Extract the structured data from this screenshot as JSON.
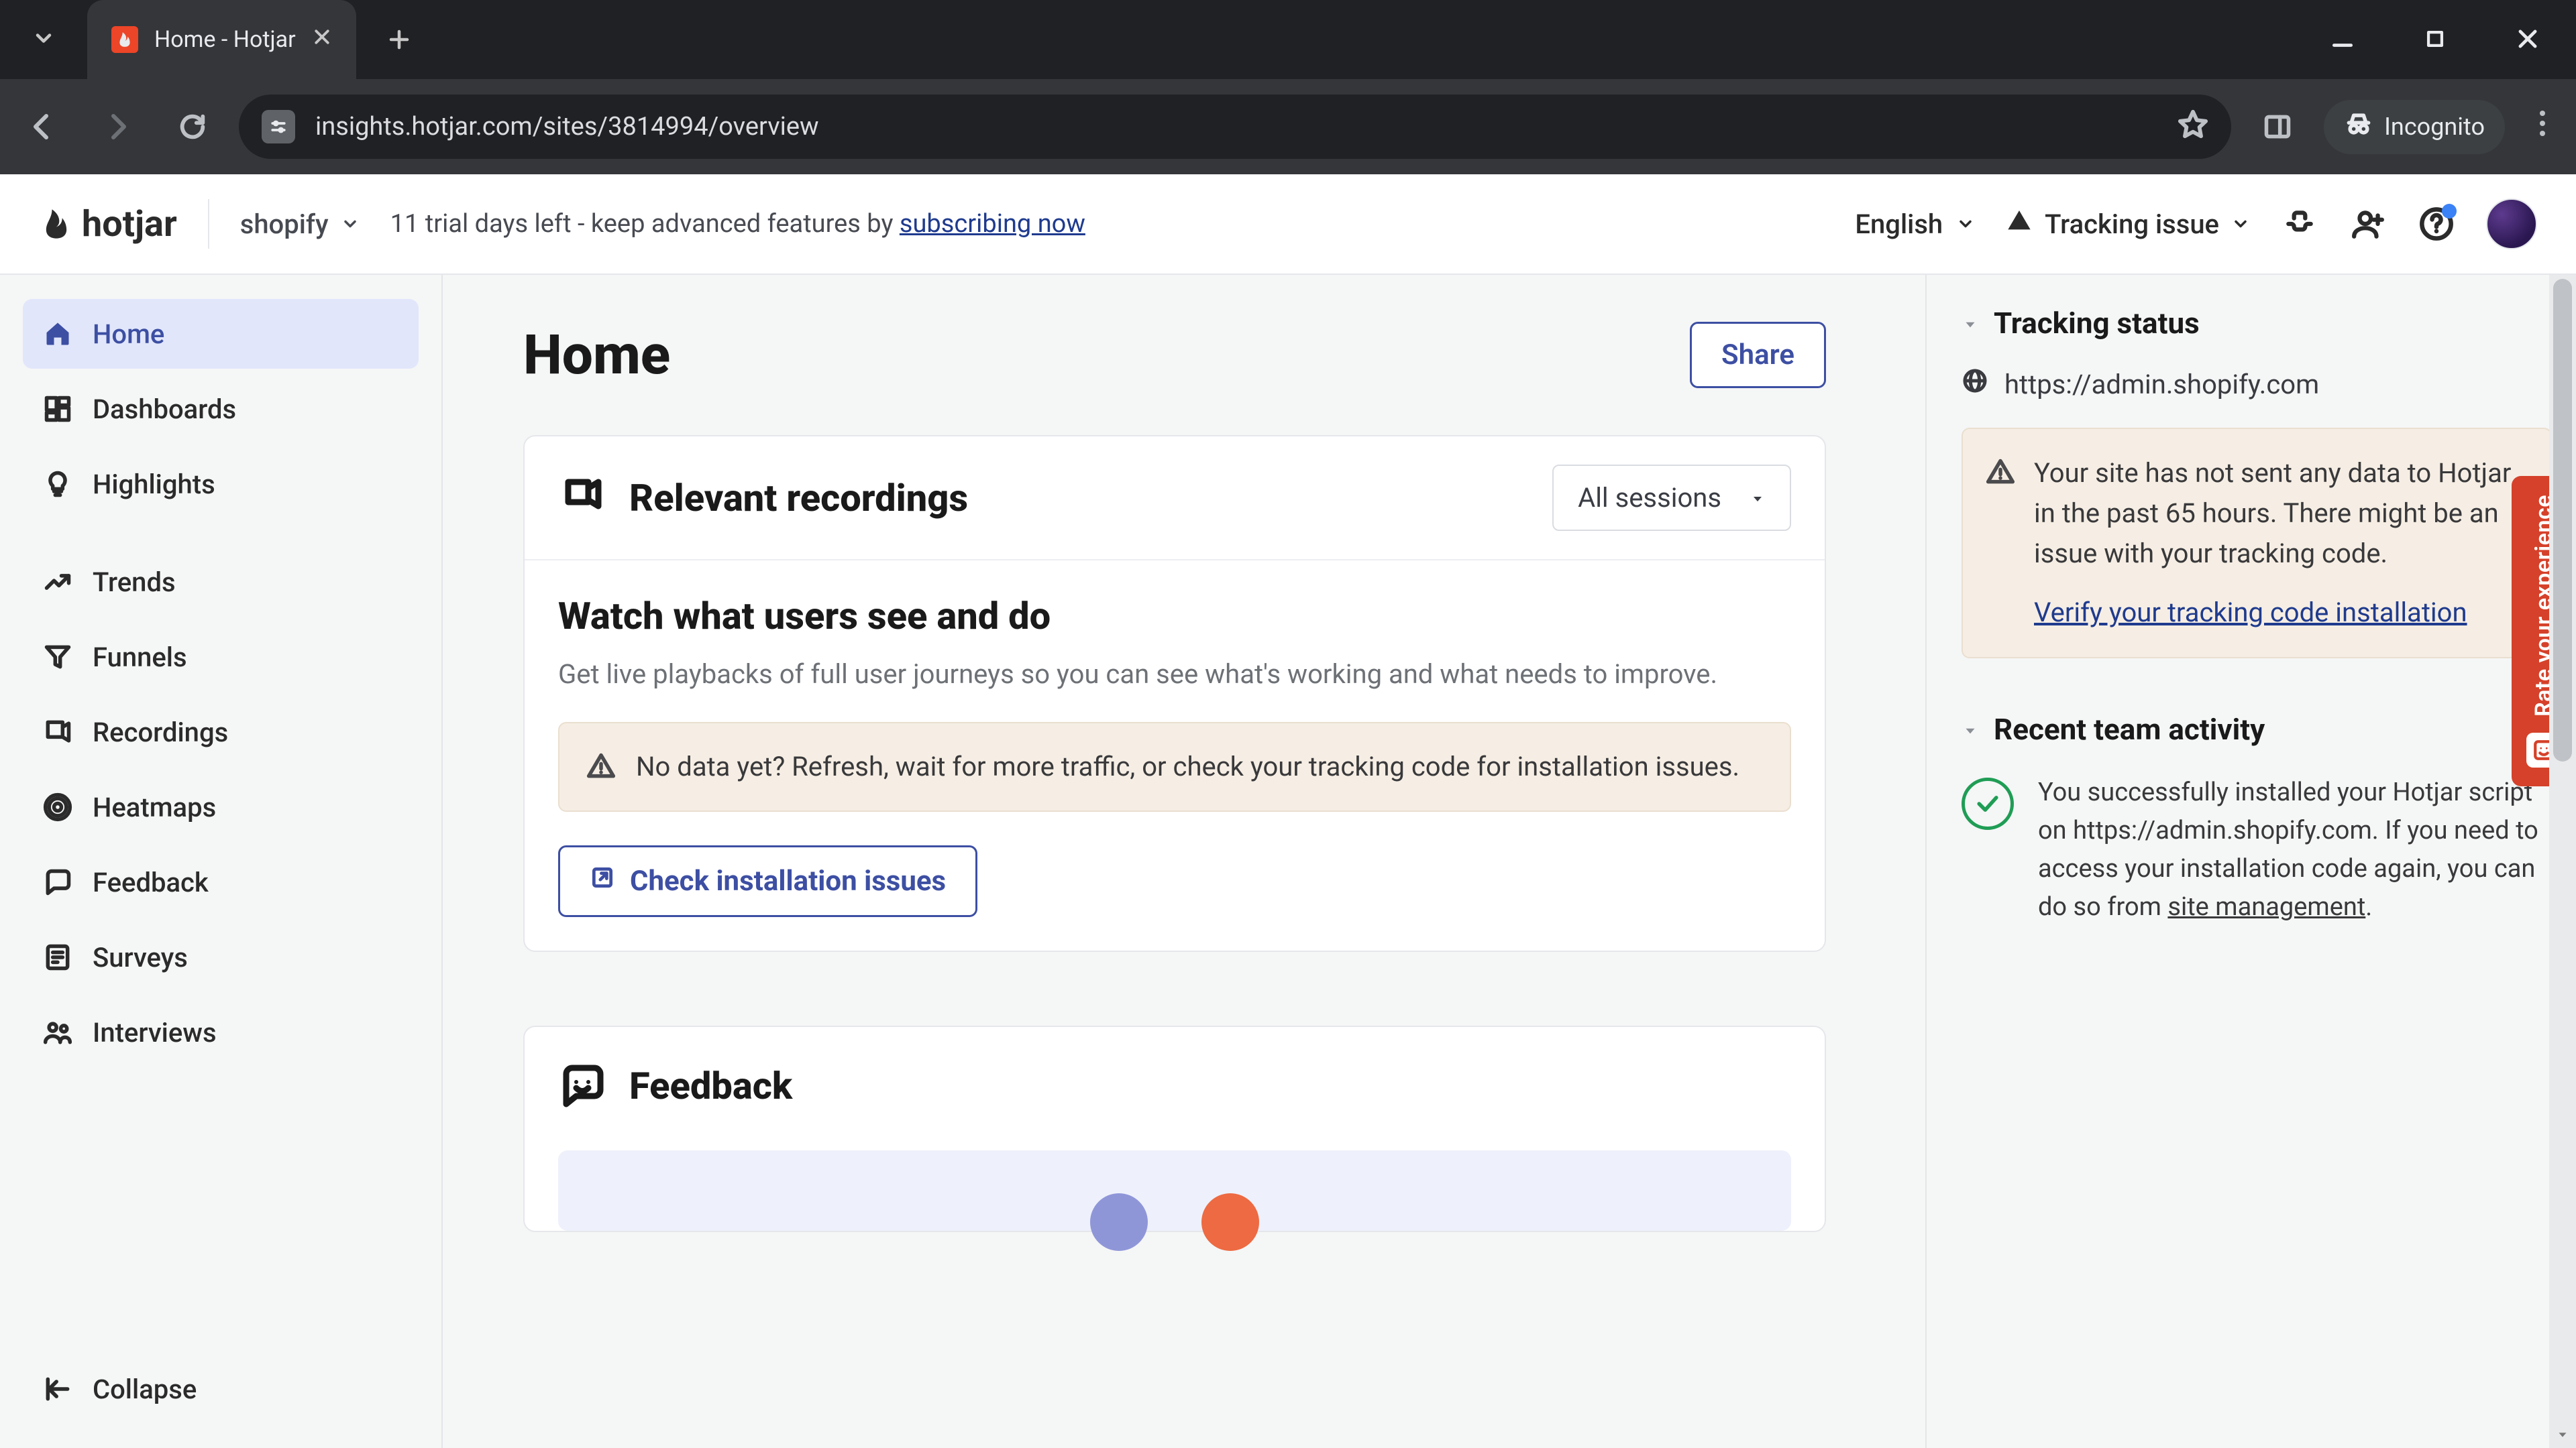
{
  "browser": {
    "tab_title": "Home - Hotjar",
    "url": "insights.hotjar.com/sites/3814994/overview",
    "incognito_label": "Incognito"
  },
  "header": {
    "logo_text": "hotjar",
    "org_name": "shopify",
    "trial_prefix": "11 trial days left - keep advanced features by ",
    "trial_link": "subscribing now",
    "language": "English",
    "tracking_label": "Tracking issue"
  },
  "sidebar": {
    "items": [
      {
        "label": "Home"
      },
      {
        "label": "Dashboards"
      },
      {
        "label": "Highlights"
      },
      {
        "label": "Trends"
      },
      {
        "label": "Funnels"
      },
      {
        "label": "Recordings"
      },
      {
        "label": "Heatmaps"
      },
      {
        "label": "Feedback"
      },
      {
        "label": "Surveys"
      },
      {
        "label": "Interviews"
      }
    ],
    "collapse_label": "Collapse"
  },
  "page": {
    "title": "Home",
    "share_label": "Share"
  },
  "recordings_card": {
    "title": "Relevant recordings",
    "sessions_select": "All sessions",
    "watch_title": "Watch what users see and do",
    "watch_sub": "Get live playbacks of full user journeys so you can see what's working and what needs to improve.",
    "alert_text": "No data yet? Refresh, wait for more traffic, or check your tracking code for installation issues.",
    "check_btn": "Check installation issues"
  },
  "feedback_card": {
    "title": "Feedback"
  },
  "right_panel": {
    "tracking_title": "Tracking status",
    "site_url": "https://admin.shopify.com",
    "warn_text": "Your site has not sent any data to Hotjar in the past 65 hours. There might be an issue with your tracking code.",
    "verify_link": "Verify your tracking code installation",
    "recent_title": "Recent team activity",
    "activity_prefix": "You successfully installed your Hotjar script on https://admin.shopify.com. If you need to access your installation code again, you can do so from ",
    "activity_link": "site management",
    "activity_suffix": "."
  },
  "feedback_rail": {
    "label": "Rate your experience"
  }
}
